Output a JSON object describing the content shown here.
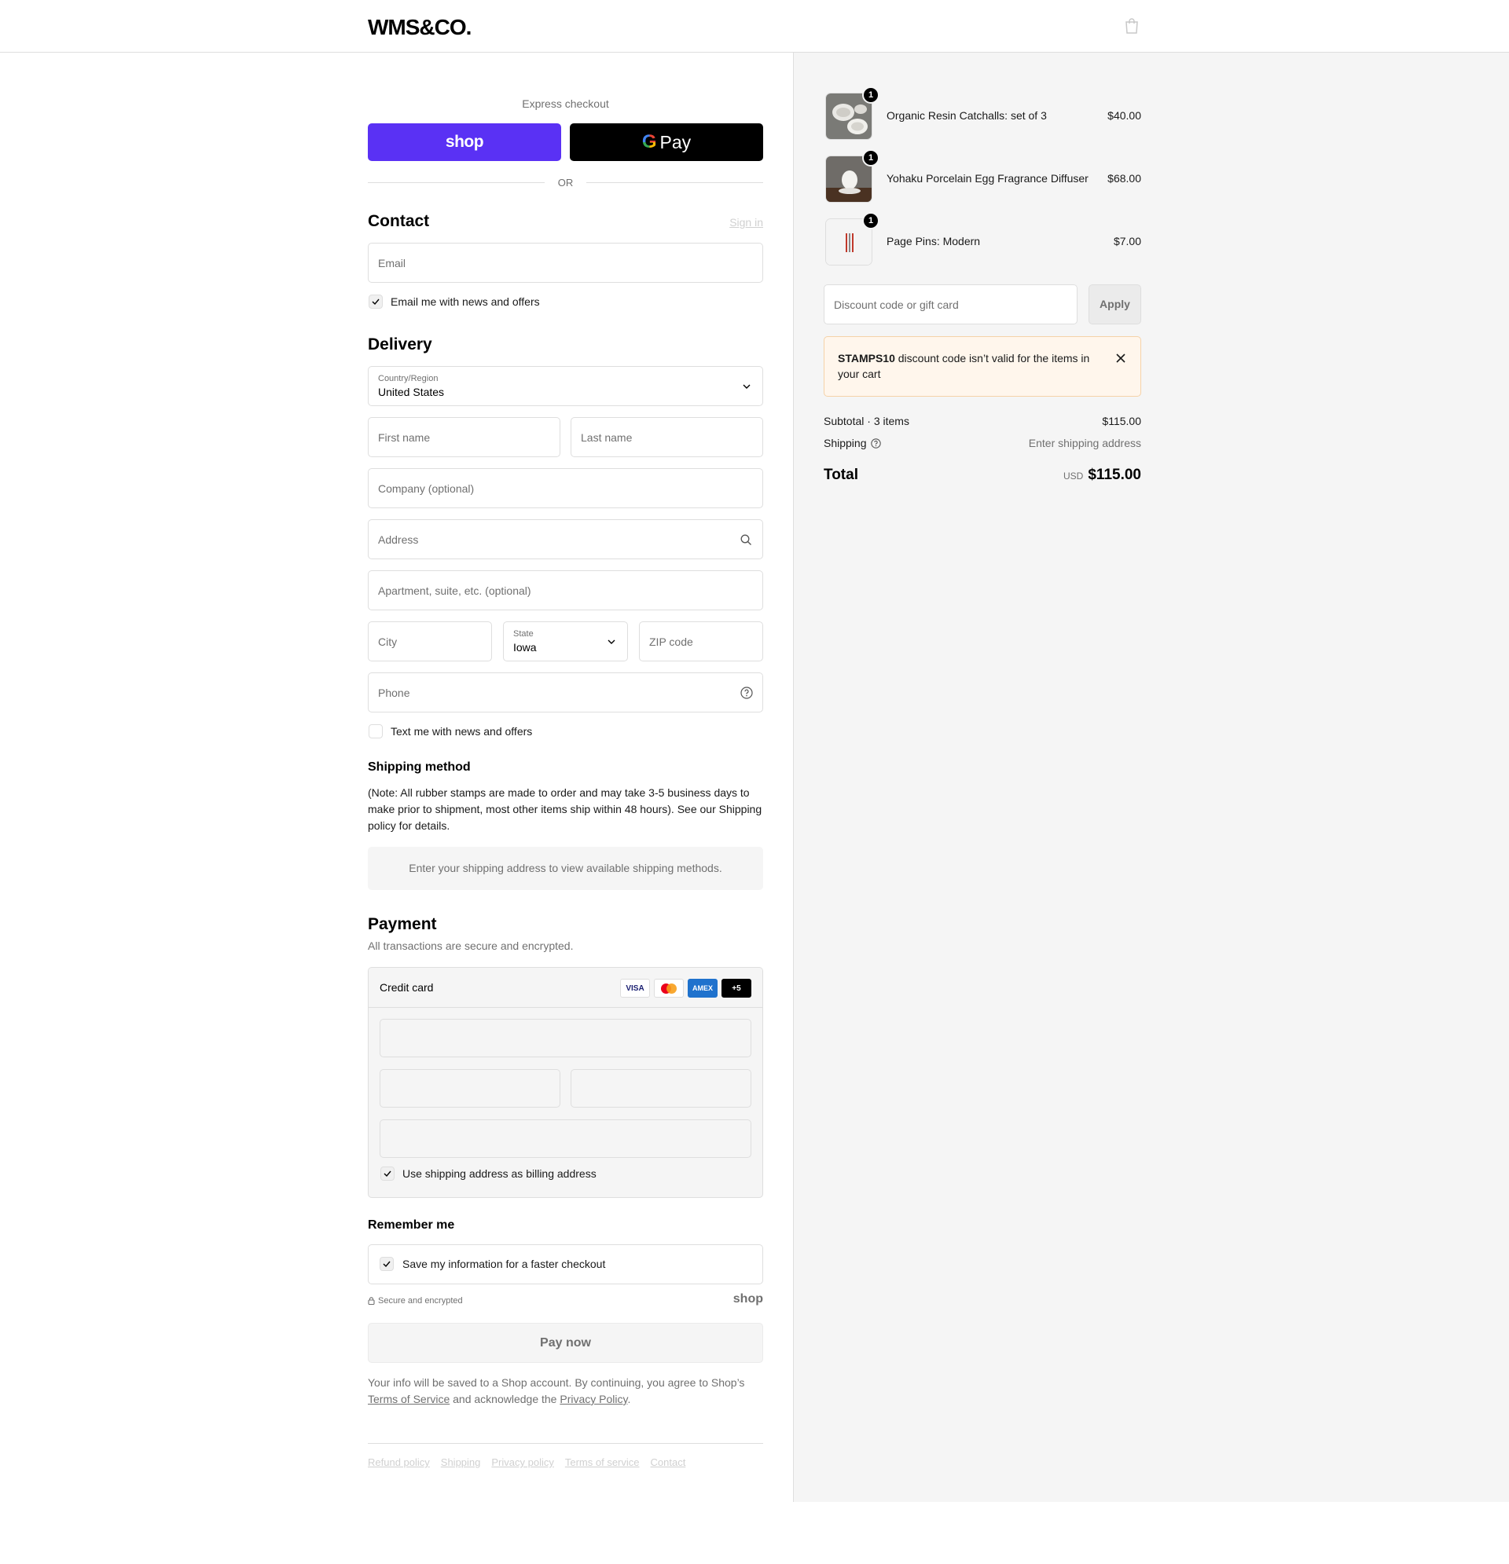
{
  "header": {
    "logo": "WMS&CO.",
    "cart_icon": "bag-icon"
  },
  "express": {
    "label": "Express checkout",
    "shop_label": "shop",
    "gpay_g": "G",
    "gpay_label": "Pay",
    "or": "OR"
  },
  "contact": {
    "title": "Contact",
    "signin": "Sign in",
    "email_placeholder": "Email",
    "news_label": "Email me with news and offers",
    "news_checked": true
  },
  "delivery": {
    "title": "Delivery",
    "country_label": "Country/Region",
    "country_value": "United States",
    "first_name": "First name",
    "last_name": "Last name",
    "company": "Company (optional)",
    "address": "Address",
    "apartment": "Apartment, suite, etc. (optional)",
    "city": "City",
    "state_label": "State",
    "state_value": "Iowa",
    "zip": "ZIP code",
    "phone": "Phone",
    "text_label": "Text me with news and offers",
    "text_checked": false
  },
  "shipping": {
    "title": "Shipping method",
    "note": "(Note: All rubber stamps are made to order and may take 3-5 business days to make prior to shipment, most other items ship within 48 hours). See our Shipping policy for details.",
    "placeholder": "Enter your shipping address to view available shipping methods."
  },
  "payment": {
    "title": "Payment",
    "subtitle": "All transactions are secure and encrypted.",
    "method": "Credit card",
    "cards": [
      "VISA",
      "",
      "AMEX",
      "+5"
    ],
    "billing_label": "Use shipping address as billing address",
    "billing_checked": true
  },
  "remember": {
    "title": "Remember me",
    "save_label": "Save my information for a faster checkout",
    "save_checked": true,
    "secure": "Secure and encrypted",
    "shop": "shop"
  },
  "pay_now": "Pay now",
  "legal": {
    "pre": "Your info will be saved to a Shop account. By continuing, you agree to Shop’s ",
    "terms": "Terms of Service",
    "mid": " and acknowledge the ",
    "privacy": "Privacy Policy",
    "post": "."
  },
  "footer_links": [
    "Refund policy",
    "Shipping",
    "Privacy policy",
    "Terms of service",
    "Contact"
  ],
  "cart": {
    "items": [
      {
        "name": "Organic Resin Catchalls: set of 3",
        "price": "$40.00",
        "qty": "1"
      },
      {
        "name": "Yohaku Porcelain Egg Fragrance Diffuser",
        "price": "$68.00",
        "qty": "1"
      },
      {
        "name": "Page Pins: Modern",
        "price": "$7.00",
        "qty": "1"
      }
    ],
    "discount_placeholder": "Discount code or gift card",
    "apply": "Apply",
    "alert_code": "STAMPS10",
    "alert_text": " discount code isn’t valid for the items in your cart",
    "subtotal_label": "Subtotal · 3 items",
    "subtotal_value": "$115.00",
    "shipping_label": "Shipping",
    "shipping_value": "Enter shipping address",
    "total_label": "Total",
    "currency": "USD",
    "total_value": "$115.00"
  },
  "colors": {
    "shop_purple": "#5a31f4",
    "alert_bg": "#fff6ec",
    "summary_bg": "#f5f5f5"
  }
}
